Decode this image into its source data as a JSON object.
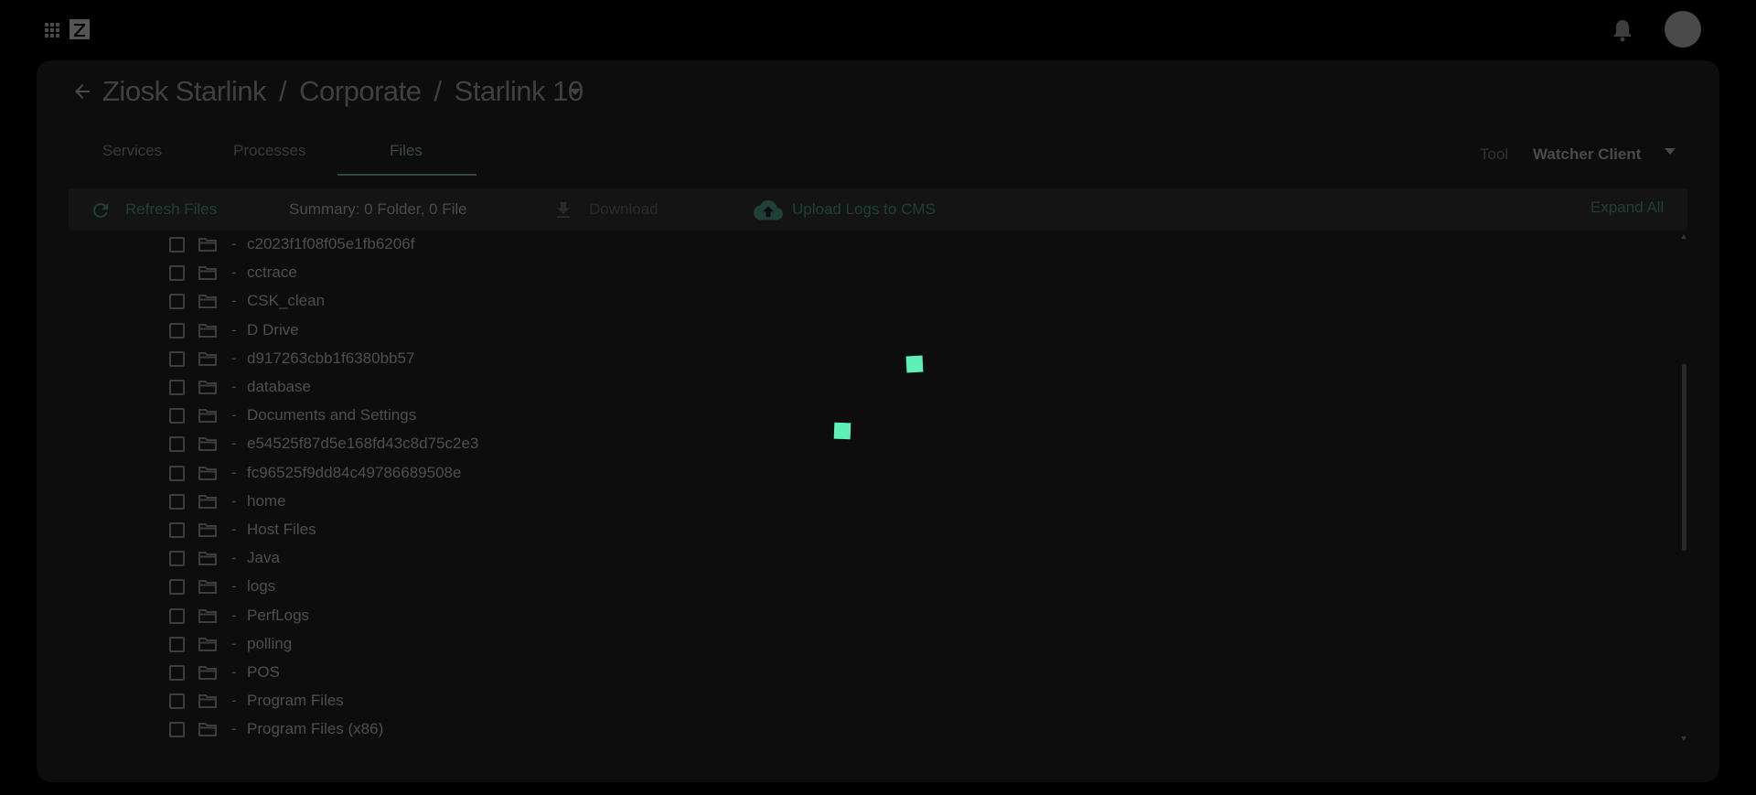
{
  "header": {
    "apps_icon": "apps-grid-icon",
    "logo_icon": "z-logo-icon",
    "notifications_icon": "bell-icon",
    "avatar": "user-avatar"
  },
  "breadcrumb": {
    "back_icon": "arrow-left-icon",
    "items": [
      "Ziosk Starlink",
      "Corporate",
      "Starlink 10"
    ],
    "separator": "/",
    "caret_icon": "caret-down-icon"
  },
  "tabs": [
    {
      "label": "Services",
      "active": false
    },
    {
      "label": "Processes",
      "active": false
    },
    {
      "label": "Files",
      "active": true
    }
  ],
  "tool": {
    "label": "Tool",
    "value": "Watcher Client",
    "caret_icon": "caret-down-icon"
  },
  "toolbar": {
    "refresh_label": "Refresh Files",
    "refresh_icon": "refresh-icon",
    "summary": "Summary: 0 Folder, 0 File",
    "download_label": "Download",
    "download_icon": "download-icon",
    "upload_label": "Upload Logs to CMS",
    "upload_icon": "cloud-upload-icon",
    "expand_label": "Expand All"
  },
  "files": {
    "dash": "-",
    "items": [
      "c2023f1f08f05e1fb6206f",
      "cctrace",
      "CSK_clean",
      "D Drive",
      "d917263cbb1f6380bb57",
      "database",
      "Documents and Settings",
      "e54525f87d5e168fd43c8d75c2e3",
      "fc96525f9dd84c49786689508e",
      "home",
      "Host Files",
      "Java",
      "logs",
      "PerfLogs",
      "polling",
      "POS",
      "Program Files",
      "Program Files (x86)"
    ]
  },
  "colors": {
    "accent": "#5ef0b8",
    "accent_dim": "#1e4036",
    "panel": "#0d0d0d",
    "background": "#000000"
  }
}
